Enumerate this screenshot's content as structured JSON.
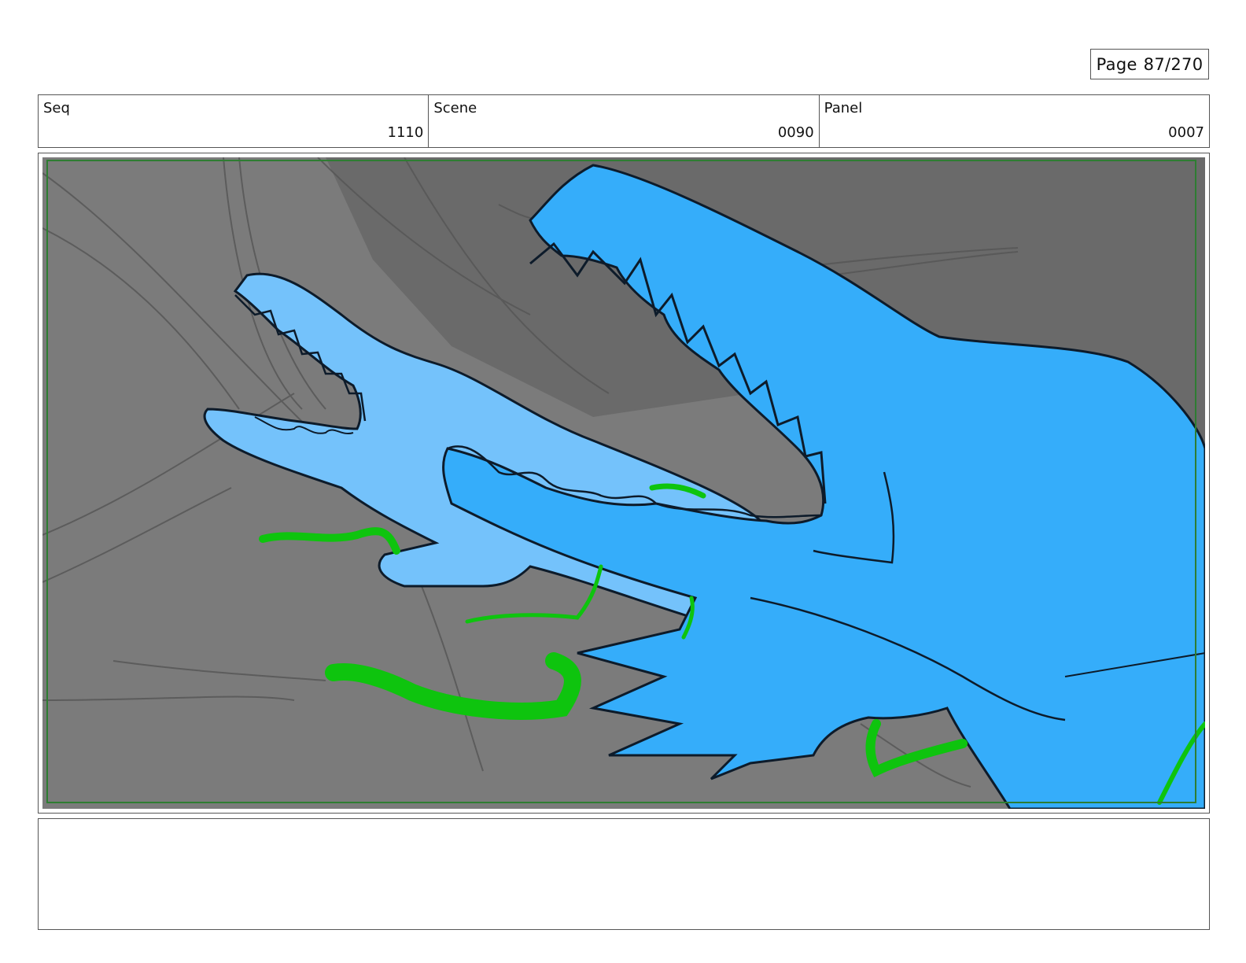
{
  "page": {
    "label": "Page",
    "number": "87/270"
  },
  "info": {
    "seq": {
      "label": "Seq",
      "value": "1110"
    },
    "scene": {
      "label": "Scene",
      "value": "0090"
    },
    "panel": {
      "label": "Panel",
      "value": "0007"
    }
  },
  "colors": {
    "background": "#7b7b7b",
    "shadow": "#6a6a6a",
    "creature_light": "#74c2fb",
    "creature_dark": "#35adfa",
    "seaweed": "#0ec40e",
    "safe_frame": "#2e7d32",
    "outline": "#0d1b2a"
  },
  "notes": {
    "text": ""
  }
}
